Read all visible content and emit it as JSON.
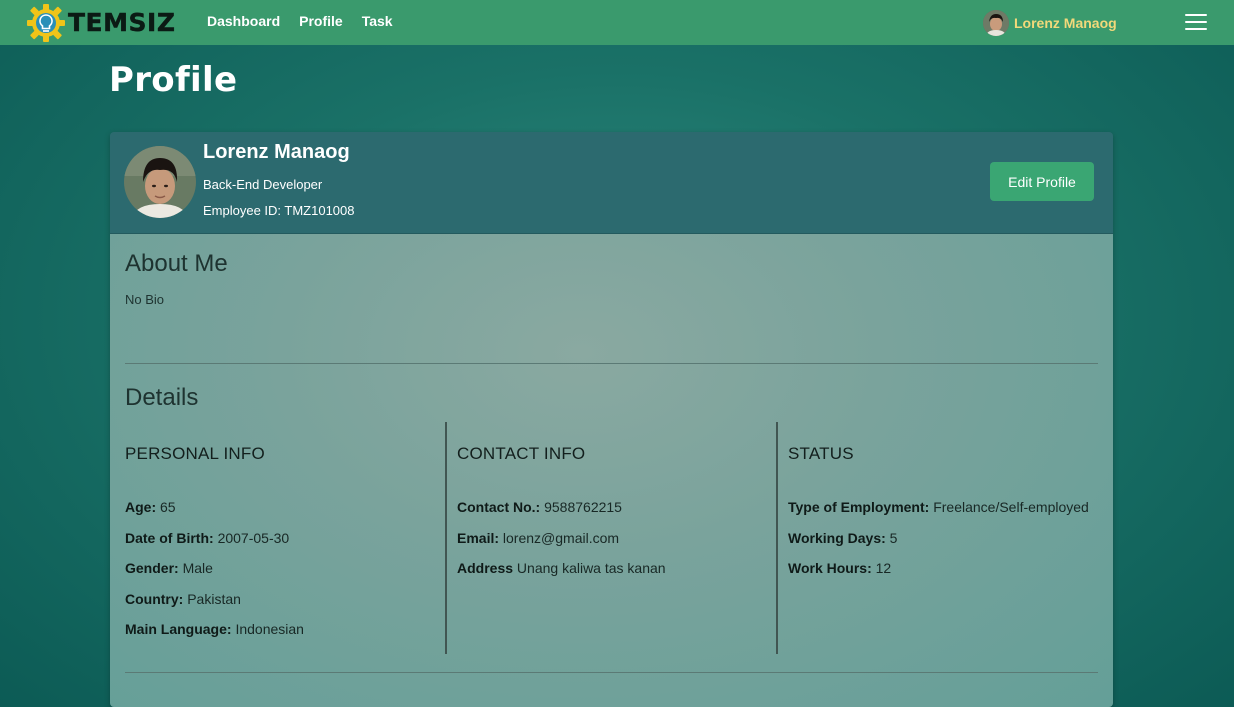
{
  "navbar": {
    "brand": "TEMSIZ",
    "links": [
      "Dashboard",
      "Profile",
      "Task"
    ],
    "user_name": "Lorenz Manaog"
  },
  "page": {
    "title": "Profile"
  },
  "profile": {
    "name": "Lorenz Manaog",
    "role": "Back-End Developer",
    "employee_id": "Employee ID: TMZ101008",
    "edit_label": "Edit Profile"
  },
  "about": {
    "title": "About Me",
    "bio": "No Bio"
  },
  "details": {
    "title": "Details",
    "personal": {
      "heading": "PERSONAL INFO",
      "rows": [
        {
          "label": "Age:",
          "value": "65"
        },
        {
          "label": "Date of Birth:",
          "value": "2007-05-30"
        },
        {
          "label": "Gender:",
          "value": "Male"
        },
        {
          "label": "Country:",
          "value": "Pakistan"
        },
        {
          "label": "Main Language:",
          "value": "Indonesian"
        }
      ]
    },
    "contact": {
      "heading": "CONTACT INFO",
      "rows": [
        {
          "label": "Contact No.:",
          "value": "9588762215"
        },
        {
          "label": "Email:",
          "value": "lorenz@gmail.com"
        },
        {
          "label": "Address",
          "value": "Unang kaliwa tas kanan"
        }
      ]
    },
    "status": {
      "heading": "STATUS",
      "rows": [
        {
          "label": "Type of Employment:",
          "value": "Freelance/Self-employed"
        },
        {
          "label": "Working Days:",
          "value": "5"
        },
        {
          "label": "Work Hours:",
          "value": "12"
        }
      ]
    }
  },
  "colors": {
    "navbar": "#3a9a6d",
    "accent_button": "#3aa673",
    "card_header": "#2c6a6f",
    "nav_user_name": "#f2d97a"
  },
  "icons": {
    "logo": "gear-lightbulb-logo-icon",
    "menu": "hamburger-menu-icon"
  }
}
